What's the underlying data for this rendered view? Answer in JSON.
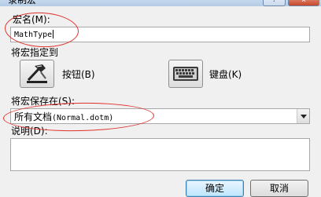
{
  "window": {
    "title": "录制宏",
    "help_button": "?",
    "close_button": "x"
  },
  "macro_name": {
    "label": "宏名(M):",
    "value": "MathType"
  },
  "assign_macro": {
    "label": "将宏指定到",
    "button_option": {
      "label": "按钮(B)",
      "icon": "hammer-icon"
    },
    "keyboard_option": {
      "label": "键盘(K)",
      "icon": "keyboard-icon"
    }
  },
  "store_macro": {
    "label": "将宏保存在(S):",
    "selected_prefix": "所有文档",
    "selected_suffix": "(Normal.dotm)"
  },
  "description": {
    "label": "说明(D):",
    "value": ""
  },
  "actions": {
    "ok": "确定",
    "cancel": "取消"
  },
  "annotations": {
    "highlight_color": "#e0302a"
  }
}
